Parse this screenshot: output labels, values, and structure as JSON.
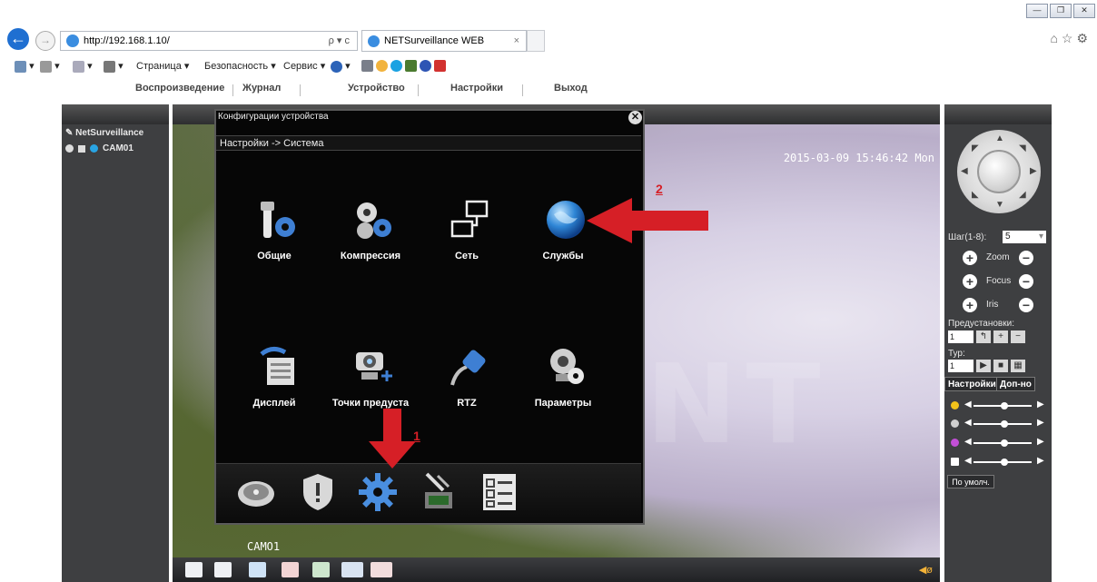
{
  "browser": {
    "url": "http://192.168.1.10/",
    "url_tools": "ρ ▾ c",
    "tab_title": "NETSurveillance WEB",
    "tab_close": "×",
    "window_buttons": [
      "—",
      "❐",
      "✕"
    ],
    "top_icons": "⌂☆⚙",
    "command_bar": [
      {
        "label": "▾",
        "icon": "home-icon"
      },
      {
        "label": "▾",
        "icon": "feeds-icon"
      },
      {
        "label": "▾",
        "icon": "mail-icon"
      },
      {
        "label": "▾",
        "icon": "print-icon"
      },
      {
        "label": "Страница ▾",
        "icon": ""
      },
      {
        "label": "Безопасность ▾",
        "icon": ""
      },
      {
        "label": "Сервис ▾",
        "icon": ""
      },
      {
        "label": "▾",
        "icon": "help-icon"
      }
    ]
  },
  "menu": {
    "items": [
      "Воспроизведение",
      "Журнал",
      "Устройство",
      "Настройки",
      "Выход"
    ]
  },
  "left_panel": {
    "root": "NetSurveillance",
    "camera": "CAM01"
  },
  "video": {
    "timestamp": "2015-03-09 15:46:42 Mon",
    "channel": "CAMO1",
    "watermark": "REXANT",
    "volume_icon": "◀ø"
  },
  "dialog": {
    "title": "Конфигурации устройства",
    "close": "✕",
    "breadcrumb": "Настройки -> Система",
    "tiles": [
      {
        "label": "Общие",
        "icon": "tools-gear-icon"
      },
      {
        "label": "Компрессия",
        "icon": "compression-gears-icon"
      },
      {
        "label": "Сеть",
        "icon": "network-icon"
      },
      {
        "label": "Службы",
        "icon": "globe-icon"
      },
      {
        "label": "Дисплей",
        "icon": "display-icon"
      },
      {
        "label": "Точки предуста",
        "icon": "camera-preset-icon"
      },
      {
        "label": "RTZ",
        "icon": "rs-cable-icon"
      },
      {
        "label": "Параметры",
        "icon": "camera-settings-icon"
      }
    ],
    "bottom_bar": [
      "hdd-icon",
      "shield-icon",
      "gear-icon",
      "tools-icon",
      "checklist-icon"
    ]
  },
  "annotations": {
    "first": "1",
    "second": "2"
  },
  "ptz": {
    "step_label": "Шаг(1-8):",
    "step_value": "5",
    "zoom": "Zoom",
    "focus": "Focus",
    "iris": "Iris",
    "plus": "+",
    "minus": "−",
    "presets_label": "Предустановки:",
    "preset_value": "1",
    "preset_buttons": [
      "↰",
      "+",
      "−"
    ],
    "tour_label": "Тур:",
    "tour_value": "1",
    "tour_buttons": [
      "▶",
      "■",
      "▦"
    ],
    "arrows": [
      "▲",
      "▼",
      "◀",
      "▶",
      "◤",
      "◥",
      "◣",
      "◢"
    ]
  },
  "settings": {
    "tab_settings": "Настройки",
    "tab_extra": "Доп-но",
    "slider_dot_colors": [
      "#f2c31a",
      "#cfcfcf",
      "#c24fd6",
      "#ffffff"
    ],
    "default_button": "По умолч."
  },
  "colors": {
    "accent_red": "#d61f26",
    "panel": "#3e3f41"
  }
}
